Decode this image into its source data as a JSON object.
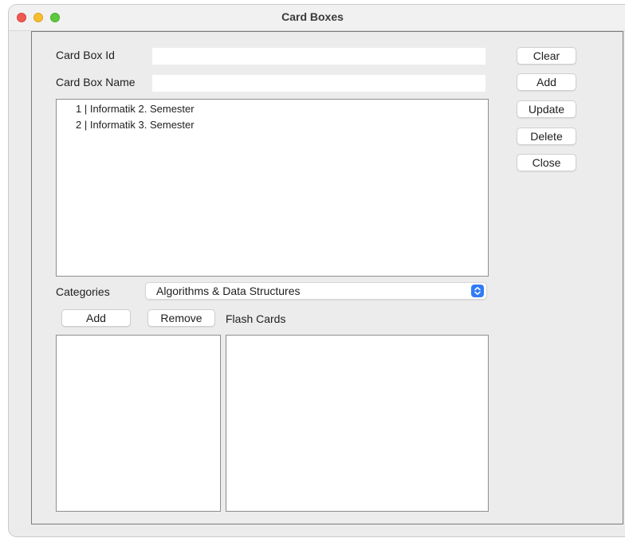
{
  "window": {
    "title": "Card Boxes"
  },
  "form": {
    "card_box_id_label": "Card Box Id",
    "card_box_id_value": "",
    "card_box_name_label": "Card Box Name",
    "card_box_name_value": ""
  },
  "actions": {
    "clear": "Clear",
    "add": "Add",
    "update": "Update",
    "delete": "Delete",
    "close": "Close"
  },
  "card_boxes": {
    "items": [
      "1 | Informatik 2. Semester",
      "2 | Informatik 3. Semester"
    ]
  },
  "categories": {
    "label": "Categories",
    "selected": "Algorithms & Data Structures",
    "add_label": "Add",
    "remove_label": "Remove"
  },
  "flash_cards": {
    "label": "Flash Cards"
  },
  "colors": {
    "accent": "#2f7cf6",
    "close_dot": "#ee5a52",
    "minimize_dot": "#f5bd2f",
    "zoom_dot": "#5cc93f",
    "window_bg": "#ececec"
  },
  "icons": {
    "combo_arrow": "chevron-up-down-icon"
  }
}
